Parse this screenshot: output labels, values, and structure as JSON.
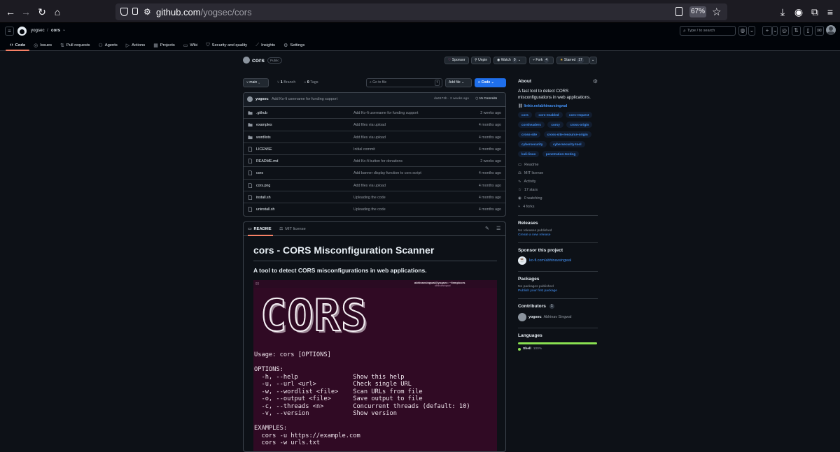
{
  "browser": {
    "url_host": "github.com",
    "url_path": "/yogsec/cors",
    "zoom": "67%"
  },
  "header": {
    "owner": "yogsec",
    "repo": "cors",
    "search_placeholder": "Type / to search",
    "search_key": "/"
  },
  "tabs": [
    {
      "label": "Code"
    },
    {
      "label": "Issues"
    },
    {
      "label": "Pull requests"
    },
    {
      "label": "Agents"
    },
    {
      "label": "Actions"
    },
    {
      "label": "Projects"
    },
    {
      "label": "Wiki"
    },
    {
      "label": "Security and quality"
    },
    {
      "label": "Insights"
    },
    {
      "label": "Settings"
    }
  ],
  "repo": {
    "name": "cors",
    "visibility": "Public",
    "sponsor": "Sponsor",
    "unpin": "Unpin",
    "watch": "Watch",
    "watch_count": "0",
    "fork": "Fork",
    "fork_count": "4",
    "starred": "Starred",
    "star_count": "17"
  },
  "toolbar": {
    "branch": "main",
    "branches_count": "1",
    "branches_label": "Branch",
    "tags_count": "0",
    "tags_label": "Tags",
    "goto_placeholder": "Go to file",
    "goto_key": "t",
    "add_file": "Add file",
    "code": "Code"
  },
  "commit": {
    "author": "yogsec",
    "message": "Add Ko-fi username for funding support",
    "hash": "da6172b",
    "age": "2 weeks ago",
    "commits": "15 Commits"
  },
  "files": [
    {
      "name": ".github",
      "type": "dir",
      "message": "Add Ko-fi username for funding support",
      "date": "2 weeks ago"
    },
    {
      "name": "examples",
      "type": "dir",
      "message": "Add files via upload",
      "date": "4 months ago"
    },
    {
      "name": "wordlists",
      "type": "dir",
      "message": "Add files via upload",
      "date": "4 months ago"
    },
    {
      "name": "LICENSE",
      "type": "file",
      "message": "Initial commit",
      "date": "4 months ago"
    },
    {
      "name": "README.md",
      "type": "file",
      "message": "Add Ko-fi button for donations",
      "date": "2 weeks ago"
    },
    {
      "name": "cors",
      "type": "file",
      "message": "Add banner display function to cors script",
      "date": "4 months ago"
    },
    {
      "name": "cors.png",
      "type": "file",
      "message": "Add files via upload",
      "date": "4 months ago"
    },
    {
      "name": "install.sh",
      "type": "file",
      "message": "Uploading the code",
      "date": "4 months ago"
    },
    {
      "name": "uninstall.sh",
      "type": "file",
      "message": "Uploading the code",
      "date": "4 months ago"
    }
  ],
  "readme": {
    "tab_readme": "README",
    "tab_license": "MIT license",
    "title": "cors - CORS Misconfiguration Scanner",
    "subtitle": "A tool to detect CORS misconfigurations in web applications.",
    "term_title": "abhinavsingwal@yogsec: ~/temp/cors",
    "term_sub": "abhinavsingwal",
    "logo": "CORS",
    "usage": "Usage: cors [OPTIONS]\n\nOPTIONS:\n  -h, --help               Show this help\n  -u, --url <url>          Check single URL\n  -w, --wordlist <file>    Scan URLs from file\n  -o, --output <file>      Save output to file\n  -c, --threads <n>        Concurrent threads (default: 10)\n  -v, --version            Show version\n\nEXAMPLES:\n  cors -u https://example.com\n  cors -w urls.txt"
  },
  "about": {
    "heading": "About",
    "description": "A fast tool to detect CORS misconfigurations in web applications.",
    "link": "linktr.ee/abhinavsingwal",
    "topics": [
      "cors",
      "cors-enabled",
      "cors-request",
      "corsheaders",
      "corsy",
      "cross-origin",
      "cross-site",
      "cross-site-resource-origin",
      "cybersecurity",
      "cybersecurity-tool",
      "kali-linux",
      "penetration-testing"
    ],
    "readme": "Readme",
    "license": "MIT license",
    "activity": "Activity",
    "stars": "17 stars",
    "watching": "0 watching",
    "forks": "4 forks"
  },
  "releases": {
    "heading": "Releases",
    "none": "No releases published",
    "create": "Create a new release"
  },
  "sponsor": {
    "heading": "Sponsor this project",
    "link": "ko-fi.com/abhinavsingwal"
  },
  "packages": {
    "heading": "Packages",
    "none": "No packages published",
    "publish": "Publish your first package"
  },
  "contributors": {
    "heading": "Contributors",
    "count": "1",
    "login": "yogsec",
    "name": "Abhinav Singwal"
  },
  "languages": {
    "heading": "Languages",
    "name": "Shell",
    "percent": "100%",
    "color": "#89e051",
    "fraction": 1.0
  }
}
